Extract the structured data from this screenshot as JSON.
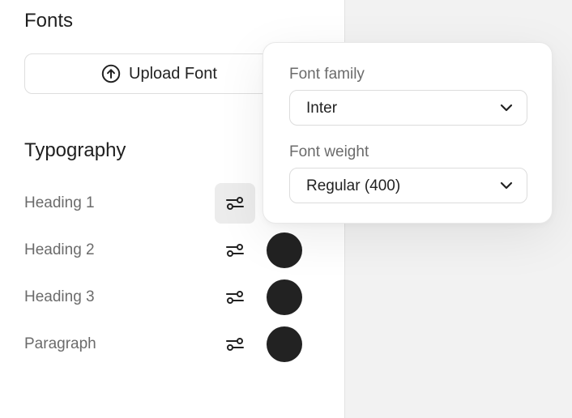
{
  "fonts": {
    "title": "Fonts",
    "upload_label": "Upload Font",
    "upload_icon": "upload-circle-icon"
  },
  "typography": {
    "title": "Typography",
    "rows": [
      {
        "label": "Heading 1",
        "settings_icon": "sliders-icon",
        "color": "#222222",
        "active": true
      },
      {
        "label": "Heading 2",
        "settings_icon": "sliders-icon",
        "color": "#222222",
        "active": false
      },
      {
        "label": "Heading 3",
        "settings_icon": "sliders-icon",
        "color": "#222222",
        "active": false
      },
      {
        "label": "Paragraph",
        "settings_icon": "sliders-icon",
        "color": "#222222",
        "active": false
      }
    ]
  },
  "popover": {
    "family_label": "Font family",
    "family_value": "Inter",
    "weight_label": "Font weight",
    "weight_value": "Regular (400)",
    "chevron_icon": "chevron-down-icon"
  }
}
